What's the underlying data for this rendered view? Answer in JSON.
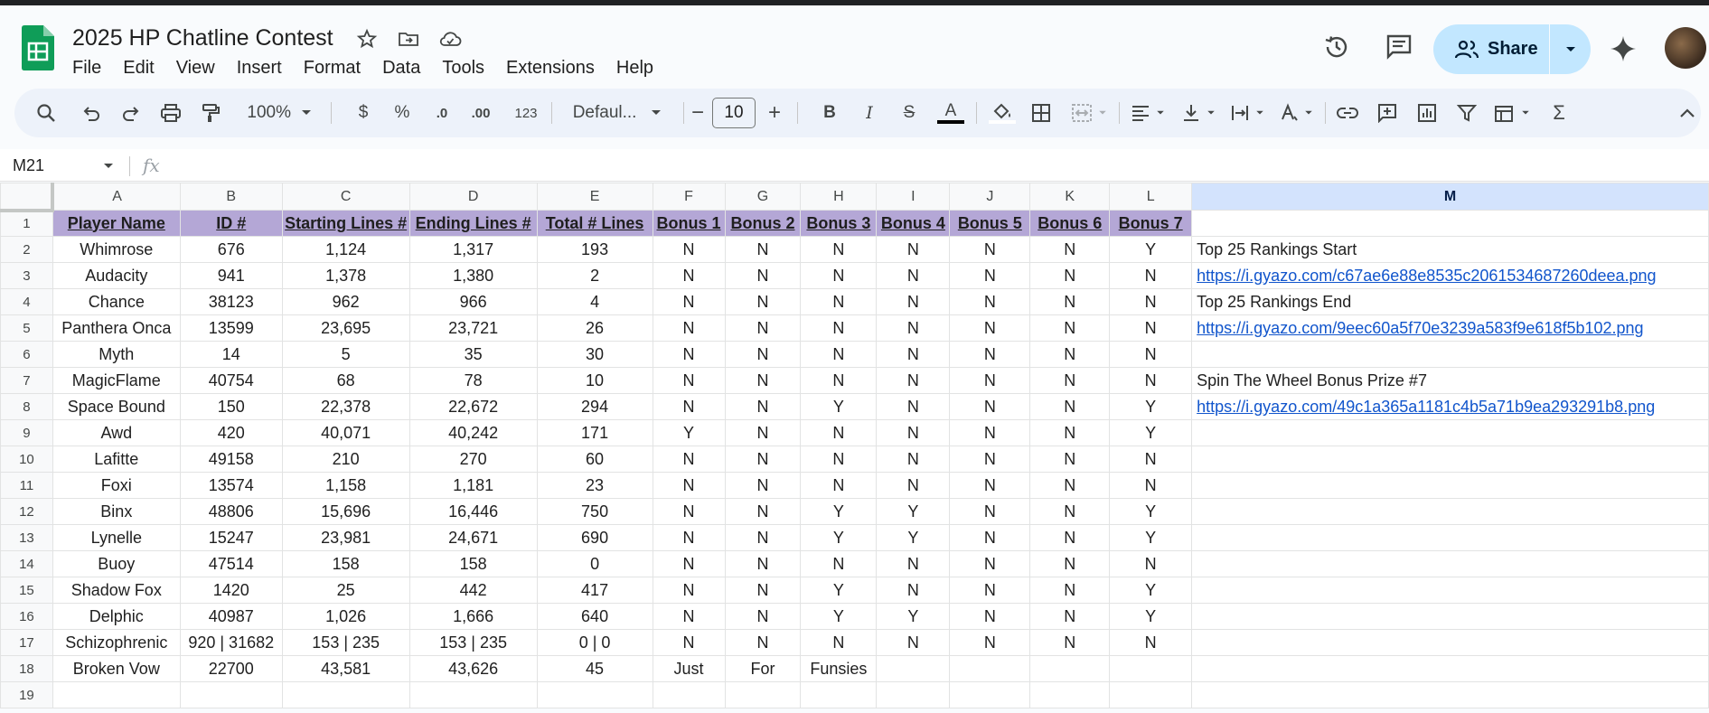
{
  "app": {
    "title": "2025 HP Chatline Contest",
    "menu": [
      "File",
      "Edit",
      "View",
      "Insert",
      "Format",
      "Data",
      "Tools",
      "Extensions",
      "Help"
    ],
    "share_label": "Share"
  },
  "toolbar": {
    "zoom": "100%",
    "currency": "$",
    "percent": "%",
    "dec_decrease": ".0",
    "dec_increase": ".00",
    "number_format": "123",
    "font": "Defaul...",
    "font_size": "10",
    "minus": "−",
    "plus": "+",
    "bold": "B",
    "italic": "I",
    "strike": "S",
    "text_color": "A",
    "sum": "Σ"
  },
  "formula_bar": {
    "cell_ref": "M21",
    "fx": "fx"
  },
  "columns": [
    "A",
    "B",
    "C",
    "D",
    "E",
    "F",
    "G",
    "H",
    "I",
    "J",
    "K",
    "L",
    "M"
  ],
  "selected_column": "M",
  "header_row": [
    "Player Name",
    "ID #",
    "Starting Lines #",
    "Ending Lines #",
    "Total # Lines",
    "Bonus 1",
    "Bonus 2",
    "Bonus 3",
    "Bonus 4",
    "Bonus 5",
    "Bonus 6",
    "Bonus 7"
  ],
  "rows": [
    [
      "Whimrose",
      "676",
      "1,124",
      "1,317",
      "193",
      "N",
      "N",
      "N",
      "N",
      "N",
      "N",
      "Y"
    ],
    [
      "Audacity",
      "941",
      "1,378",
      "1,380",
      "2",
      "N",
      "N",
      "N",
      "N",
      "N",
      "N",
      "N"
    ],
    [
      "Chance",
      "38123",
      "962",
      "966",
      "4",
      "N",
      "N",
      "N",
      "N",
      "N",
      "N",
      "N"
    ],
    [
      "Panthera Onca",
      "13599",
      "23,695",
      "23,721",
      "26",
      "N",
      "N",
      "N",
      "N",
      "N",
      "N",
      "N"
    ],
    [
      "Myth",
      "14",
      "5",
      "35",
      "30",
      "N",
      "N",
      "N",
      "N",
      "N",
      "N",
      "N"
    ],
    [
      "MagicFlame",
      "40754",
      "68",
      "78",
      "10",
      "N",
      "N",
      "N",
      "N",
      "N",
      "N",
      "N"
    ],
    [
      "Space Bound",
      "150",
      "22,378",
      "22,672",
      "294",
      "N",
      "N",
      "Y",
      "N",
      "N",
      "N",
      "Y"
    ],
    [
      "Awd",
      "420",
      "40,071",
      "40,242",
      "171",
      "Y",
      "N",
      "N",
      "N",
      "N",
      "N",
      "Y"
    ],
    [
      "Lafitte",
      "49158",
      "210",
      "270",
      "60",
      "N",
      "N",
      "N",
      "N",
      "N",
      "N",
      "N"
    ],
    [
      "Foxi",
      "13574",
      "1,158",
      "1,181",
      "23",
      "N",
      "N",
      "N",
      "N",
      "N",
      "N",
      "N"
    ],
    [
      "Binx",
      "48806",
      "15,696",
      "16,446",
      "750",
      "N",
      "N",
      "Y",
      "Y",
      "N",
      "N",
      "Y"
    ],
    [
      "Lynelle",
      "15247",
      "23,981",
      "24,671",
      "690",
      "N",
      "N",
      "Y",
      "Y",
      "N",
      "N",
      "Y"
    ],
    [
      "Buoy",
      "47514",
      "158",
      "158",
      "0",
      "N",
      "N",
      "N",
      "N",
      "N",
      "N",
      "N"
    ],
    [
      "Shadow Fox",
      "1420",
      "25",
      "442",
      "417",
      "N",
      "N",
      "Y",
      "N",
      "N",
      "N",
      "Y"
    ],
    [
      "Delphic",
      "40987",
      "1,026",
      "1,666",
      "640",
      "N",
      "N",
      "Y",
      "Y",
      "N",
      "N",
      "Y"
    ],
    [
      "Schizophrenic",
      "920 | 31682",
      "153 | 235",
      "153 | 235",
      "0 | 0",
      "N",
      "N",
      "N",
      "N",
      "N",
      "N",
      "N"
    ],
    [
      "Broken Vow",
      "22700",
      "43,581",
      "43,626",
      "45",
      "Just",
      "For",
      "Funsies",
      "",
      "",
      "",
      ""
    ],
    [
      "",
      "",
      "",
      "",
      "",
      "",
      "",
      "",
      "",
      "",
      "",
      ""
    ]
  ],
  "column_m": [
    {
      "text": "",
      "link": false
    },
    {
      "text": "Top 25 Rankings Start",
      "link": false
    },
    {
      "text": "https://i.gyazo.com/c67ae6e88e8535c2061534687260deea.png",
      "link": true
    },
    {
      "text": "Top 25 Rankings End",
      "link": false
    },
    {
      "text": "https://i.gyazo.com/9eec60a5f70e3239a583f9e618f5b102.png",
      "link": true
    },
    {
      "text": "",
      "link": false
    },
    {
      "text": "Spin The Wheel Bonus Prize #7",
      "link": false
    },
    {
      "text": "https://i.gyazo.com/49c1a365a1181c4b5a71b9ea293291b8.png",
      "link": true
    },
    {
      "text": "",
      "link": false
    },
    {
      "text": "",
      "link": false
    },
    {
      "text": "",
      "link": false
    },
    {
      "text": "",
      "link": false
    },
    {
      "text": "",
      "link": false
    },
    {
      "text": "",
      "link": false
    },
    {
      "text": "",
      "link": false
    },
    {
      "text": "",
      "link": false
    },
    {
      "text": "",
      "link": false
    },
    {
      "text": "",
      "link": false
    },
    {
      "text": "",
      "link": false
    }
  ],
  "colors": {
    "header_fill": "#b4a7d6",
    "share_button": "#c2e7ff",
    "link": "#1155cc",
    "sheets_green": "#0f9d58"
  }
}
